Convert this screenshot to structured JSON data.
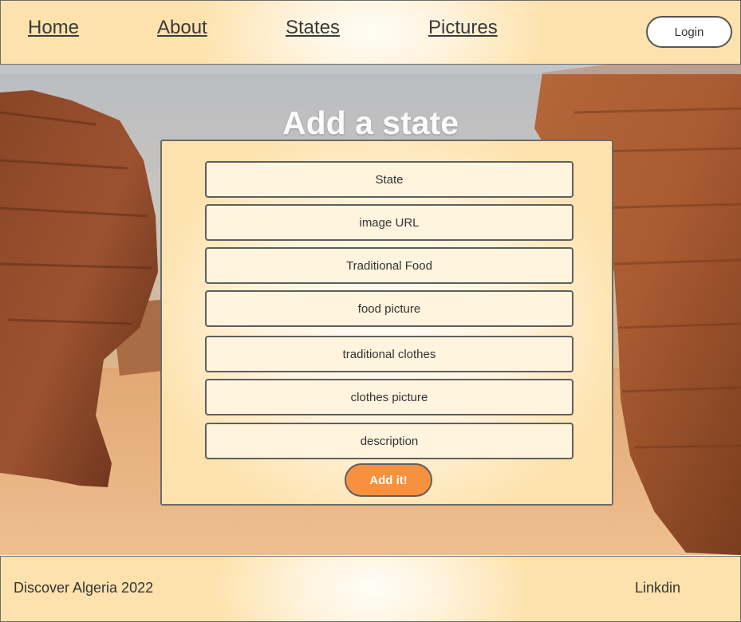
{
  "nav": {
    "home": "Home",
    "about": "About",
    "states": "States",
    "pictures": "Pictures",
    "login": "Login"
  },
  "main": {
    "title": "Add a state",
    "fields": {
      "state": "State",
      "image_url": "image URL",
      "traditional_food": "Traditional Food",
      "food_picture": "food picture",
      "traditional_clothes": "traditional clothes",
      "clothes_picture": "clothes picture",
      "description": "description"
    },
    "submit": "Add it!"
  },
  "footer": {
    "copyright": "Discover Algeria  2022",
    "linkedin": "Linkdin"
  },
  "colors": {
    "accent": "#f7913f",
    "panel": "#fde2ad",
    "field": "#fff4de"
  }
}
